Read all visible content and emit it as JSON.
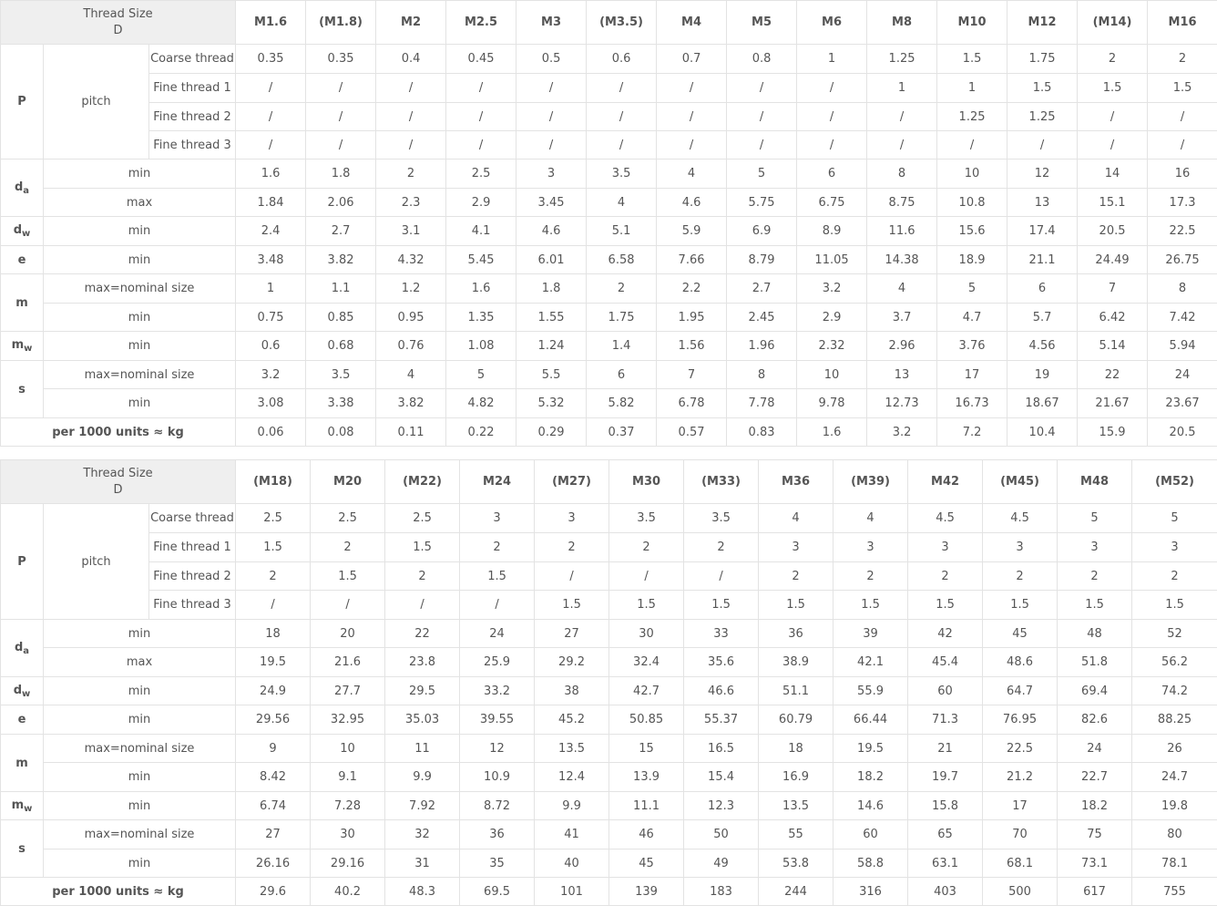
{
  "header_label_1": "Thread Size",
  "header_label_2": "D",
  "row_labels": {
    "P": "P",
    "pitch": "pitch",
    "coarse": "Coarse thread",
    "fine1": "Fine thread 1",
    "fine2": "Fine thread 2",
    "fine3": "Fine thread 3",
    "da_main": "d",
    "da_sub": "a",
    "dw_main": "d",
    "dw_sub": "w",
    "e": "e",
    "m": "m",
    "mw_main": "m",
    "mw_sub": "w",
    "s": "s",
    "min": "min",
    "max": "max",
    "max_nominal": "max=nominal size",
    "weight": "per 1000 units ≈ kg"
  },
  "tables": [
    {
      "sizes": [
        "M1.6",
        "(M1.8)",
        "M2",
        "M2.5",
        "M3",
        "(M3.5)",
        "M4",
        "M5",
        "M6",
        "M8",
        "M10",
        "M12",
        "(M14)",
        "M16"
      ],
      "coarse": [
        "0.35",
        "0.35",
        "0.4",
        "0.45",
        "0.5",
        "0.6",
        "0.7",
        "0.8",
        "1",
        "1.25",
        "1.5",
        "1.75",
        "2",
        "2"
      ],
      "fine1": [
        "/",
        "/",
        "/",
        "/",
        "/",
        "/",
        "/",
        "/",
        "/",
        "1",
        "1",
        "1.5",
        "1.5",
        "1.5"
      ],
      "fine2": [
        "/",
        "/",
        "/",
        "/",
        "/",
        "/",
        "/",
        "/",
        "/",
        "/",
        "1.25",
        "1.25",
        "/",
        "/"
      ],
      "fine3": [
        "/",
        "/",
        "/",
        "/",
        "/",
        "/",
        "/",
        "/",
        "/",
        "/",
        "/",
        "/",
        "/",
        "/"
      ],
      "da_min": [
        "1.6",
        "1.8",
        "2",
        "2.5",
        "3",
        "3.5",
        "4",
        "5",
        "6",
        "8",
        "10",
        "12",
        "14",
        "16"
      ],
      "da_max": [
        "1.84",
        "2.06",
        "2.3",
        "2.9",
        "3.45",
        "4",
        "4.6",
        "5.75",
        "6.75",
        "8.75",
        "10.8",
        "13",
        "15.1",
        "17.3"
      ],
      "dw_min": [
        "2.4",
        "2.7",
        "3.1",
        "4.1",
        "4.6",
        "5.1",
        "5.9",
        "6.9",
        "8.9",
        "11.6",
        "15.6",
        "17.4",
        "20.5",
        "22.5"
      ],
      "e_min": [
        "3.48",
        "3.82",
        "4.32",
        "5.45",
        "6.01",
        "6.58",
        "7.66",
        "8.79",
        "11.05",
        "14.38",
        "18.9",
        "21.1",
        "24.49",
        "26.75"
      ],
      "m_max": [
        "1",
        "1.1",
        "1.2",
        "1.6",
        "1.8",
        "2",
        "2.2",
        "2.7",
        "3.2",
        "4",
        "5",
        "6",
        "7",
        "8"
      ],
      "m_min": [
        "0.75",
        "0.85",
        "0.95",
        "1.35",
        "1.55",
        "1.75",
        "1.95",
        "2.45",
        "2.9",
        "3.7",
        "4.7",
        "5.7",
        "6.42",
        "7.42"
      ],
      "mw_min": [
        "0.6",
        "0.68",
        "0.76",
        "1.08",
        "1.24",
        "1.4",
        "1.56",
        "1.96",
        "2.32",
        "2.96",
        "3.76",
        "4.56",
        "5.14",
        "5.94"
      ],
      "s_max": [
        "3.2",
        "3.5",
        "4",
        "5",
        "5.5",
        "6",
        "7",
        "8",
        "10",
        "13",
        "17",
        "19",
        "22",
        "24"
      ],
      "s_min": [
        "3.08",
        "3.38",
        "3.82",
        "4.82",
        "5.32",
        "5.82",
        "6.78",
        "7.78",
        "9.78",
        "12.73",
        "16.73",
        "18.67",
        "21.67",
        "23.67"
      ],
      "weight": [
        "0.06",
        "0.08",
        "0.11",
        "0.22",
        "0.29",
        "0.37",
        "0.57",
        "0.83",
        "1.6",
        "3.2",
        "7.2",
        "10.4",
        "15.9",
        "20.5"
      ]
    },
    {
      "sizes": [
        "(M18)",
        "M20",
        "(M22)",
        "M24",
        "(M27)",
        "M30",
        "(M33)",
        "M36",
        "(M39)",
        "M42",
        "(M45)",
        "M48",
        "(M52)"
      ],
      "coarse": [
        "2.5",
        "2.5",
        "2.5",
        "3",
        "3",
        "3.5",
        "3.5",
        "4",
        "4",
        "4.5",
        "4.5",
        "5",
        "5"
      ],
      "fine1": [
        "1.5",
        "2",
        "1.5",
        "2",
        "2",
        "2",
        "2",
        "3",
        "3",
        "3",
        "3",
        "3",
        "3"
      ],
      "fine2": [
        "2",
        "1.5",
        "2",
        "1.5",
        "/",
        "/",
        "/",
        "2",
        "2",
        "2",
        "2",
        "2",
        "2"
      ],
      "fine3": [
        "/",
        "/",
        "/",
        "/",
        "1.5",
        "1.5",
        "1.5",
        "1.5",
        "1.5",
        "1.5",
        "1.5",
        "1.5",
        "1.5"
      ],
      "da_min": [
        "18",
        "20",
        "22",
        "24",
        "27",
        "30",
        "33",
        "36",
        "39",
        "42",
        "45",
        "48",
        "52"
      ],
      "da_max": [
        "19.5",
        "21.6",
        "23.8",
        "25.9",
        "29.2",
        "32.4",
        "35.6",
        "38.9",
        "42.1",
        "45.4",
        "48.6",
        "51.8",
        "56.2"
      ],
      "dw_min": [
        "24.9",
        "27.7",
        "29.5",
        "33.2",
        "38",
        "42.7",
        "46.6",
        "51.1",
        "55.9",
        "60",
        "64.7",
        "69.4",
        "74.2"
      ],
      "e_min": [
        "29.56",
        "32.95",
        "35.03",
        "39.55",
        "45.2",
        "50.85",
        "55.37",
        "60.79",
        "66.44",
        "71.3",
        "76.95",
        "82.6",
        "88.25"
      ],
      "m_max": [
        "9",
        "10",
        "11",
        "12",
        "13.5",
        "15",
        "16.5",
        "18",
        "19.5",
        "21",
        "22.5",
        "24",
        "26"
      ],
      "m_min": [
        "8.42",
        "9.1",
        "9.9",
        "10.9",
        "12.4",
        "13.9",
        "15.4",
        "16.9",
        "18.2",
        "19.7",
        "21.2",
        "22.7",
        "24.7"
      ],
      "mw_min": [
        "6.74",
        "7.28",
        "7.92",
        "8.72",
        "9.9",
        "11.1",
        "12.3",
        "13.5",
        "14.6",
        "15.8",
        "17",
        "18.2",
        "19.8"
      ],
      "s_max": [
        "27",
        "30",
        "32",
        "36",
        "41",
        "46",
        "50",
        "55",
        "60",
        "65",
        "70",
        "75",
        "80"
      ],
      "s_min": [
        "26.16",
        "29.16",
        "31",
        "35",
        "40",
        "45",
        "49",
        "53.8",
        "58.8",
        "63.1",
        "68.1",
        "73.1",
        "78.1"
      ],
      "weight": [
        "29.6",
        "40.2",
        "48.3",
        "69.5",
        "101",
        "139",
        "183",
        "244",
        "316",
        "403",
        "500",
        "617",
        "755"
      ]
    }
  ]
}
